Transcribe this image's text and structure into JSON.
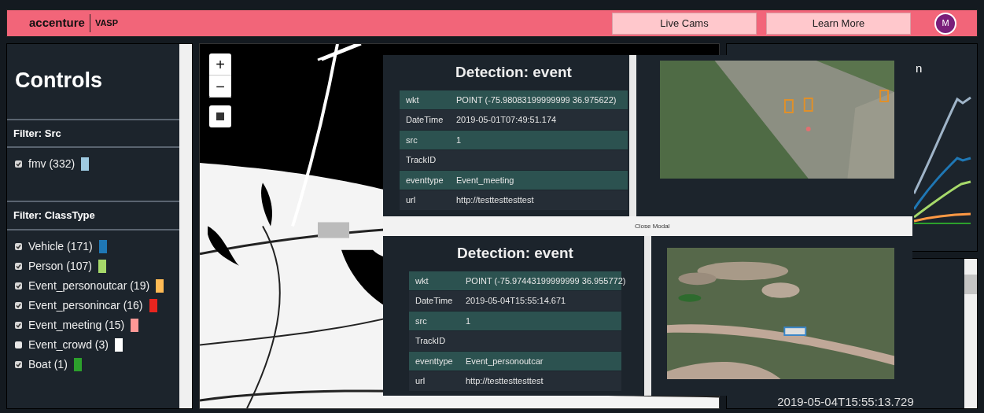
{
  "header": {
    "logo": "accenture",
    "app": "VASP",
    "buttons": [
      "Live Cams",
      "Learn More"
    ],
    "avatar": "M"
  },
  "controls": {
    "title": "Controls",
    "sections": [
      {
        "heading": "Filter: Src",
        "items": [
          {
            "label": "fmv (332)",
            "checked": true,
            "color": "#9ecae1"
          }
        ]
      },
      {
        "heading": "Filter: ClassType",
        "items": [
          {
            "label": "Vehicle (171)",
            "checked": true,
            "color": "#1f77b4"
          },
          {
            "label": "Person (107)",
            "checked": true,
            "color": "#a6d96a"
          },
          {
            "label": "Event_personoutcar (19)",
            "checked": true,
            "color": "#ffbb55"
          },
          {
            "label": "Event_personincar (16)",
            "checked": true,
            "color": "#e8251f"
          },
          {
            "label": "Event_meeting (15)",
            "checked": true,
            "color": "#ff9896"
          },
          {
            "label": "Event_crowd (3)",
            "checked": false,
            "color": "#ffffff"
          },
          {
            "label": "Boat (1)",
            "checked": true,
            "color": "#2ca02c"
          }
        ]
      }
    ]
  },
  "map": {
    "zoom_buttons": [
      "+",
      "−"
    ]
  },
  "chart_panel": {
    "title": "n"
  },
  "time_panel": {
    "timestamp": "2019-05-04T15:55:13.729"
  },
  "modals": [
    {
      "title": "Detection: event",
      "fields": [
        {
          "key": "wkt",
          "value": "POINT (-75.98083199999999 36.975622)"
        },
        {
          "key": "DateTime",
          "value": "2019-05-01T07:49:51.174"
        },
        {
          "key": "src",
          "value": "1"
        },
        {
          "key": "TrackID"
        },
        {
          "key": "eventtype",
          "value": "Event_meeting"
        },
        {
          "key": "url",
          "value": "http://testtesttesttest"
        }
      ],
      "frame": {
        "kind": "picture"
      }
    },
    {
      "title": "Detection: event",
      "fields": [
        {
          "key": "wkt",
          "value": "POINT (-75.97443199999999 36.955772)"
        },
        {
          "key": "DateTime",
          "value": "2019-05-04T15:55:14.671"
        },
        {
          "key": "src",
          "value": "1"
        },
        {
          "key": "TrackID"
        },
        {
          "key": "eventtype",
          "value": "Event_personoutcar"
        },
        {
          "key": "url",
          "value": "http://testtesttesttest"
        }
      ],
      "frame": {
        "kind": "picture"
      }
    }
  ],
  "close_button": "Close Modal"
}
